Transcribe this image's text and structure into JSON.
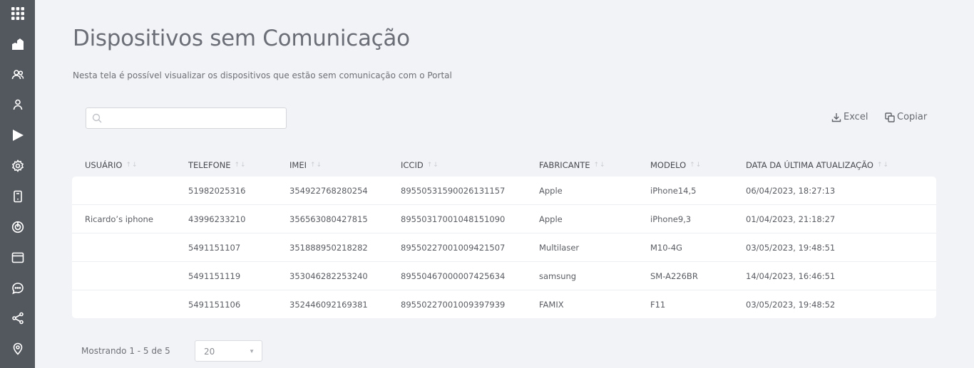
{
  "sidebar": {
    "icons": [
      "apps-grid-icon",
      "dashboard-icon",
      "users-icon",
      "user-icon",
      "play-icon",
      "settings-icon",
      "device-icon",
      "radar-icon",
      "browser-icon",
      "chat-icon",
      "share-icon",
      "location-icon"
    ]
  },
  "page": {
    "title": "Dispositivos sem Comunicação",
    "description": "Nesta tela é possível visualizar os dispositivos que estão sem comunicação com o Portal"
  },
  "search": {
    "value": "",
    "placeholder": ""
  },
  "toolbar": {
    "excel_label": "Excel",
    "copy_label": "Copiar"
  },
  "table": {
    "columns": [
      "USUÁRIO",
      "TELEFONE",
      "IMEI",
      "ICCID",
      "FABRICANTE",
      "MODELO",
      "DATA DA ÚLTIMA ATUALIZAÇÃO"
    ],
    "rows": [
      [
        "",
        "51982025316",
        "354922768280254",
        "89550531590026131157",
        "Apple",
        "iPhone14,5",
        "06/04/2023, 18:27:13"
      ],
      [
        "Ricardo’s iphone",
        "43996233210",
        "356563080427815",
        "89550317001048151090",
        "Apple",
        "iPhone9,3",
        "01/04/2023, 21:18:27"
      ],
      [
        "",
        "5491151107",
        "351888950218282",
        "89550227001009421507",
        "Multilaser",
        "M10-4G",
        "03/05/2023, 19:48:51"
      ],
      [
        "",
        "5491151119",
        "353046282253240",
        "89550467000007425634",
        "samsung",
        "SM-A226BR",
        "14/04/2023, 16:46:51"
      ],
      [
        "",
        "5491151106",
        "352446092169381",
        "89550227001009397939",
        "FAMIX",
        "F11",
        "03/05/2023, 19:48:52"
      ]
    ]
  },
  "pagination": {
    "summary": "Mostrando 1 - 5 de 5",
    "page_size": "20"
  },
  "colors": {
    "sidebar_bg": "#53575e",
    "page_bg": "#f2f3f7",
    "card_bg": "#ffffff"
  }
}
